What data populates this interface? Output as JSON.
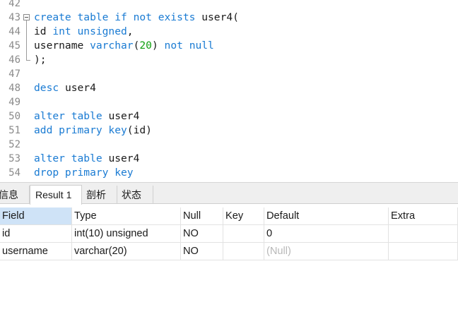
{
  "editor": {
    "lines": [
      {
        "num": "42",
        "tokens": []
      },
      {
        "num": "43",
        "tokens": [
          {
            "t": "kw",
            "v": "create table if not exists"
          },
          {
            "t": "id",
            "v": " user4("
          }
        ]
      },
      {
        "num": "44",
        "tokens": [
          {
            "t": "id",
            "v": "id "
          },
          {
            "t": "kw",
            "v": "int unsigned"
          },
          {
            "t": "id",
            "v": ","
          }
        ]
      },
      {
        "num": "45",
        "tokens": [
          {
            "t": "id",
            "v": "username "
          },
          {
            "t": "kw",
            "v": "varchar"
          },
          {
            "t": "id",
            "v": "("
          },
          {
            "t": "num",
            "v": "20"
          },
          {
            "t": "id",
            "v": ") "
          },
          {
            "t": "kw",
            "v": "not null"
          }
        ]
      },
      {
        "num": "46",
        "tokens": [
          {
            "t": "id",
            "v": ");"
          }
        ]
      },
      {
        "num": "47",
        "tokens": []
      },
      {
        "num": "48",
        "tokens": [
          {
            "t": "kw",
            "v": "desc"
          },
          {
            "t": "id",
            "v": " user4"
          }
        ]
      },
      {
        "num": "49",
        "tokens": []
      },
      {
        "num": "50",
        "tokens": [
          {
            "t": "kw",
            "v": "alter table"
          },
          {
            "t": "id",
            "v": " user4"
          }
        ]
      },
      {
        "num": "51",
        "tokens": [
          {
            "t": "kw",
            "v": "add primary key"
          },
          {
            "t": "id",
            "v": "(id)"
          }
        ]
      },
      {
        "num": "52",
        "tokens": []
      },
      {
        "num": "53",
        "tokens": [
          {
            "t": "kw",
            "v": "alter table"
          },
          {
            "t": "id",
            "v": " user4"
          }
        ]
      },
      {
        "num": "54",
        "tokens": [
          {
            "t": "kw",
            "v": "drop primary key"
          }
        ]
      }
    ]
  },
  "tabs": [
    {
      "label": "信息",
      "active": false
    },
    {
      "label": "Result 1",
      "active": true
    },
    {
      "label": "剖析",
      "active": false
    },
    {
      "label": "状态",
      "active": false
    }
  ],
  "grid": {
    "columns": [
      "Field",
      "Type",
      "Null",
      "Key",
      "Default",
      "Extra"
    ],
    "rows": [
      [
        "id",
        "int(10) unsigned",
        "NO",
        "",
        "0",
        ""
      ],
      [
        "username",
        "varchar(20)",
        "NO",
        "",
        "(Null)",
        ""
      ]
    ]
  },
  "colors": {
    "keyword": "#1a7bd3",
    "number": "#10a010",
    "null_text": "#b8b8b8",
    "selected_header": "#cfe3f7"
  }
}
